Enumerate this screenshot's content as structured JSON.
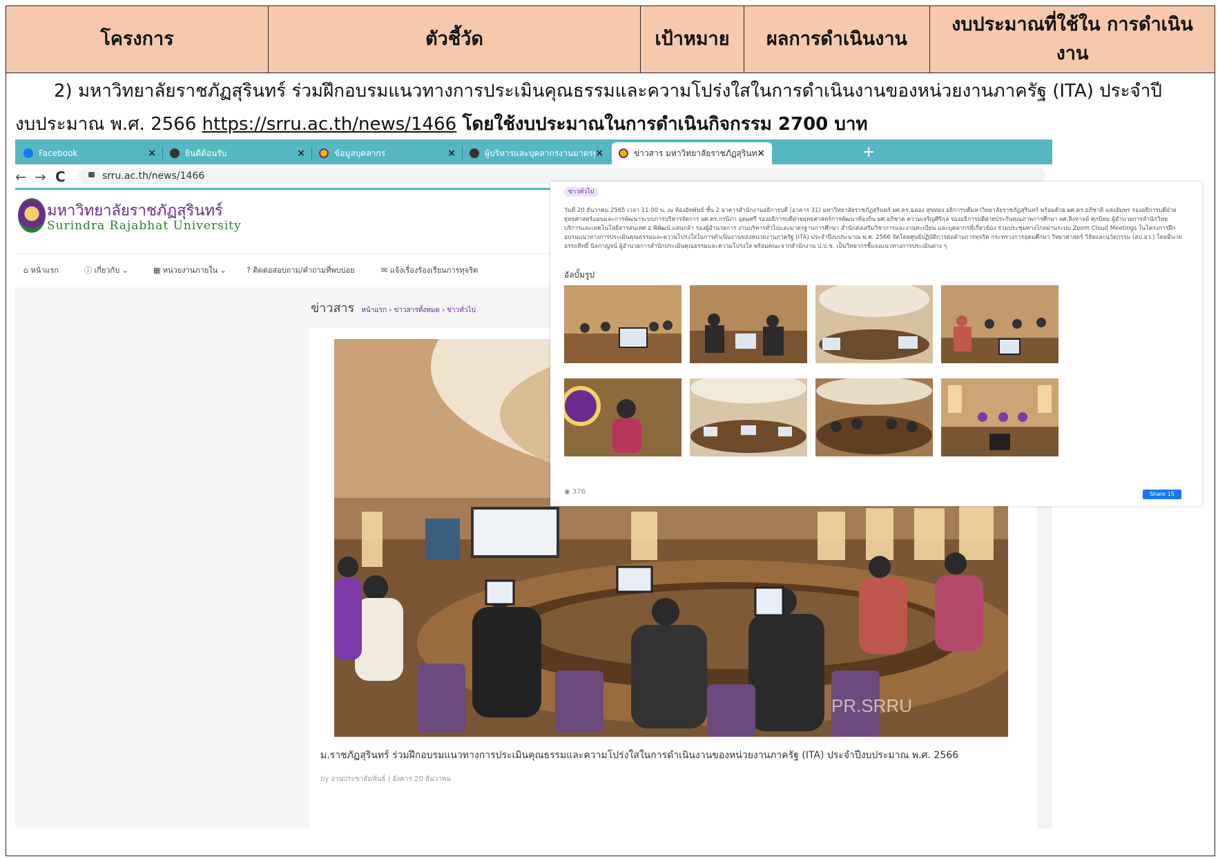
{
  "table": {
    "headers": [
      "โครงการ",
      "ตัวชี้วัด",
      "เป้าหมาย",
      "ผลการดำเนินงาน",
      "งบประมาณที่ใช้ใน การดำเนินงาน"
    ]
  },
  "paragraph": {
    "line1": "2) มหาวิทยาลัยราชภัฏสุรินทร์ ร่วมฝึกอบรมแนวทางการประเมินคุณธรรมและความโปร่งใสในการดำเนินงานของหน่วยงานภาครัฐ (ITA) ประจำปี",
    "line2_prefix": "งบประมาณ พ.ศ. 2566 ",
    "link": "https://srru.ac.th/news/1466",
    "budget_text": "โดยใช้งบประมาณในการดำเนินกิจกรรม 2700 บาท"
  },
  "browser": {
    "tabs": [
      {
        "label": "Facebook",
        "icon": "facebook-icon",
        "color": "#1877f2"
      },
      {
        "label": "ยินดีต้อนรับ",
        "icon": "globe-icon",
        "color": "#333333"
      },
      {
        "label": "ข้อมูลบุคลากร",
        "icon": "university-logo-icon",
        "color": "#f4b400"
      },
      {
        "label": "ผู้บริหารและบุคลากรงานมาตรฐานการศึ",
        "icon": "globe-icon",
        "color": "#333333"
      },
      {
        "label": "ข่าวสาร มหาวิทยาลัยราชภัฏสุรินทร์ | S",
        "icon": "university-logo-icon",
        "color": "#f4b400"
      }
    ],
    "new_tab": "+",
    "address": "srru.ac.th/news/1466"
  },
  "site": {
    "name_th": "มหาวิทยาลัยราชภัฏสุรินทร์",
    "name_en": "Surindra Rajabhat University",
    "menu": [
      "หน้าแรก",
      "เกี่ยวกับ ⌄",
      "หน่วยงานภายใน ⌄",
      "ติดต่อสอบถาม/คำถามที่พบบ่อย",
      "แจ้งเรื่องร้องเรียนการทุจริต"
    ],
    "section_title": "ข่าวสาร",
    "breadcrumb": "หน้าแรก  ›  ข่าวสารทั้งหมด  ›  ข่าวทั่วไป",
    "caption": "ม.ราชภัฏสุรินทร์ ร่วมฝึกอบรมแนวทางการประเมินคุณธรรมและความโปร่งใสในการดำเนินงานของหน่วยงานภาครัฐ (ITA) ประจำปีงบประมาณ พ.ศ. 2566",
    "byline": "by  งานประชาสัมพันธ์  |  อังคาร 20 ธันวาคม",
    "watermark": "PR.SRRU"
  },
  "overlay": {
    "tag": "ข่าวทั่วไป",
    "body": "วันที่ 20 ธันวาคม 2565 เวลา 11.00 น. ณ ห้องอัทพันธ์ ชั้น 2 อาคารสำนักงานอธิการบดี (อาคาร 31) มหาวิทยาลัยราชภัฏสุรินทร์ ผศ.ดร.ฉลอง สุขทอง อธิการบดีมหาวิทยาลัยราชภัฏสุรินทร์ พร้อมด้วย ผศ.ดร.อภิชาติ แสงอัมพร รองอธิการบดีฝ่ายยุทธศาสตร์แผนและการพัฒนาระบบการบริหารจัดการ ผศ.ดร.กรนิภา อุดมศรี รองอธิการบดีฝ่ายยุทธศาสตร์การพัฒนาท้องถิ่น ผศ.อภิชาต ความเจริญศิริกุล รองอธิการบดีฝ่ายประกันคุณภาพการศึกษา ผศ.สิงหาลย์ ศุภนิยม ผู้อำนวยการสำนักวิทยบริการและเทคโนโลยีสารสนเทศ อ.พิพัฒน์ แสนกล้า รองผู้อำนวยการ งานบริหารทั่วไปและมาตรฐานการศึกษา สำนักส่งเสริมวิชาการและงานทะเบียน และบุคลากรที่เกี่ยวข้อง ร่วมประชุมทางไกลผ่านระบบ Zoom Cloud Meetings ในโครงการฝึกอบรมแนวทางการประเมินคุณธรรมและความโปร่งใสในการดำเนินงานของหน่วยงานภาครัฐ (ITA) ประจำปีงบประมาณ พ.ศ. 2566 จัดโดยศูนย์ปฏิบัติการต่อต้านการทุจริต กระทรวงการอุดมศึกษา วิทยาศาสตร์ วิจัยและนวัตกรรม (สป.อว.) โดยมีนายอรรถสิทธิ์ นิลกาญจน์ ผู้อำนวยการสำนักประเมินคุณธรรมและความโปร่งใส พร้อมคณะจากสำนักงาน ป.ป.ช. เป็นวิทยากรชี้แจงแนวทางการประเมินต่าง ๆ",
    "album_label": "อัลบั้มรูป",
    "views": "376",
    "share": "Share 15"
  }
}
